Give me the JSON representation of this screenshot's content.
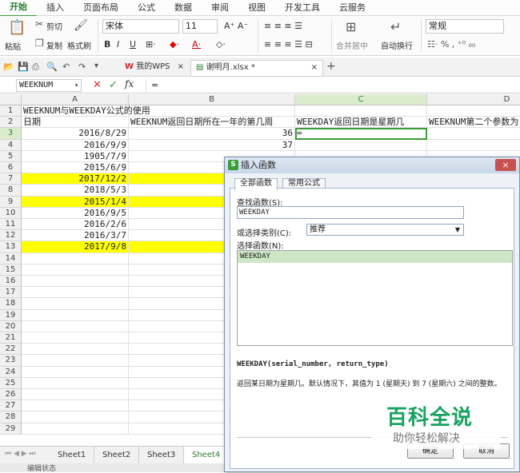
{
  "menu": {
    "tabs": [
      "开始",
      "插入",
      "页面布局",
      "公式",
      "数据",
      "审阅",
      "视图",
      "开发工具",
      "云服务"
    ],
    "active": "开始"
  },
  "ribbon": {
    "paste": "粘贴",
    "cut": "剪切",
    "copy": "复制",
    "format_painter": "格式刷",
    "font_name": "宋体",
    "font_size": "11",
    "merge_center": "合并居中",
    "wrap_text": "自动换行",
    "number_format": "常规",
    "bold": "B",
    "italic": "I",
    "underline": "U"
  },
  "doc_tabs": [
    {
      "label": "我的WPS",
      "close": "×"
    },
    {
      "label": "谢明月.xlsx *",
      "close": "×"
    }
  ],
  "new_tab": "+",
  "formula_bar": {
    "name_box": "WEEKNUM",
    "fx": "fx",
    "value": "="
  },
  "columns": [
    "A",
    "B",
    "C",
    "D"
  ],
  "rows": [
    "1",
    "2",
    "3",
    "4",
    "5",
    "6",
    "7",
    "8",
    "9",
    "10",
    "11",
    "12",
    "13",
    "14",
    "15",
    "16",
    "17",
    "18",
    "19",
    "20",
    "21",
    "22",
    "23",
    "24",
    "25",
    "26",
    "27",
    "28",
    "29"
  ],
  "cells": {
    "a1": "WEEKNUM与WEEKDAY公式的使用",
    "a2": "日期",
    "b2": "WEEKNUM返回日期所在一年的第几周",
    "c2": "WEEKDAY返回日期是星期几",
    "d2": "WEEKNUM第二个参数为",
    "c3": "=",
    "dates": [
      "2016/8/29",
      "2016/9/9",
      "1905/7/9",
      "2015/6/9",
      "2017/12/2",
      "2018/5/3",
      "2015/1/4",
      "2016/9/5",
      "2016/2/6",
      "2016/3/7",
      "2017/9/8"
    ],
    "highlighted_rows": [
      7,
      9,
      13
    ],
    "weeknums": [
      "36",
      "37"
    ]
  },
  "sheets": [
    "Sheet1",
    "Sheet2",
    "Sheet3",
    "Sheet4"
  ],
  "active_sheet": "Sheet4",
  "status": "编辑状态",
  "dialog": {
    "title": "插入函数",
    "tabs": [
      "全部函数",
      "常用公式"
    ],
    "search_label": "查找函数(S):",
    "search_value": "WEEKDAY",
    "category_label": "或选择类别(C):",
    "category_value": "推荐",
    "select_label": "选择函数(N):",
    "functions": [
      "WEEKDAY"
    ],
    "signature": "WEEKDAY(serial_number, return_type)",
    "description": "返回某日期为星期几。默认情况下，其值为 1 (星期天) 到 7 (星期六) 之间的整数。",
    "ok": "确定",
    "cancel": "取消",
    "close": "×"
  },
  "watermark": {
    "title": "百科全说",
    "subtitle": "助你轻松解决"
  },
  "colors": {
    "accent": "#2e7d32",
    "highlight": "#ffff00",
    "selected_fn": "#cde7c6"
  }
}
